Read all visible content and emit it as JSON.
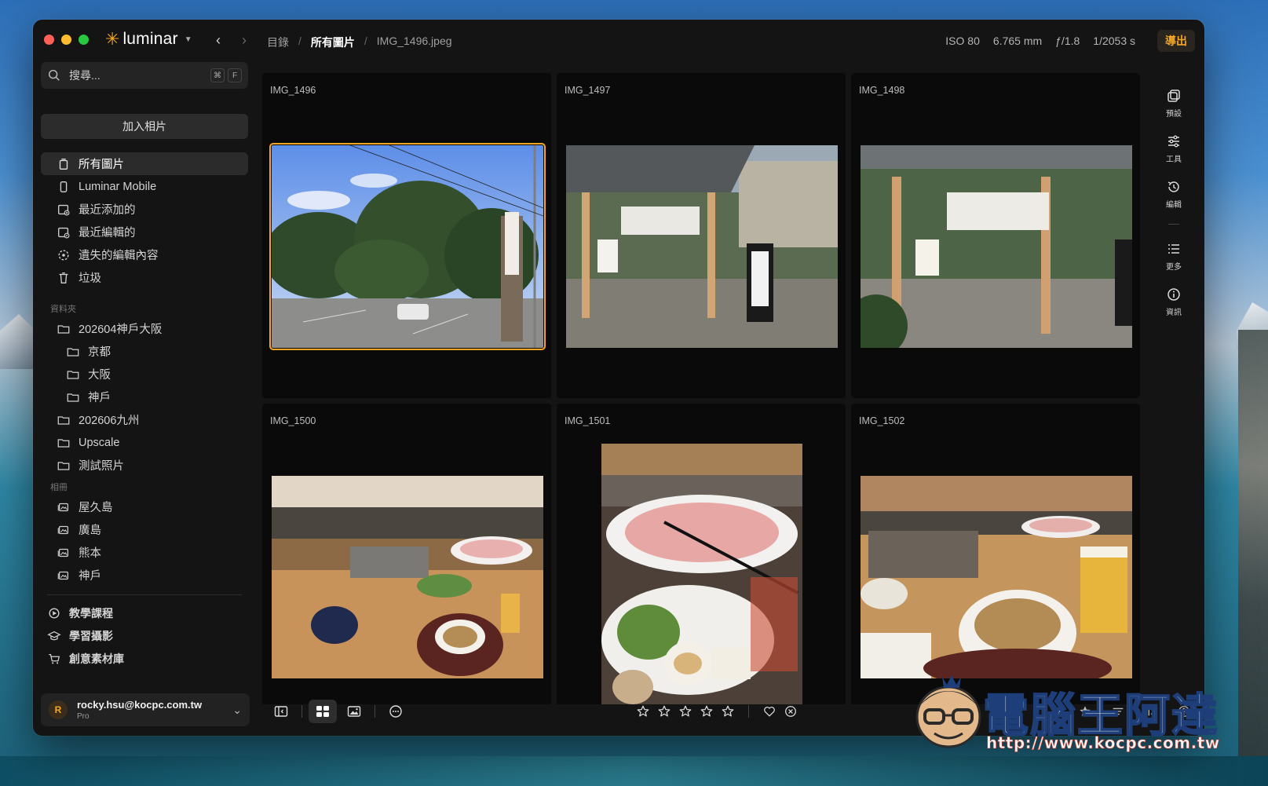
{
  "app": {
    "name": "luminar"
  },
  "breadcrumb": {
    "root": "目錄",
    "folder": "所有圖片",
    "file": "IMG_1496.jpeg"
  },
  "exif": {
    "iso": "ISO 80",
    "focal": "6.765 mm",
    "aperture": "ƒ/1.8",
    "shutter": "1/2053 s"
  },
  "toolbar": {
    "export_label": "導出"
  },
  "search": {
    "placeholder": "搜尋...",
    "key1": "⌘",
    "key2": "F"
  },
  "sidebar": {
    "add_photos": "加入相片",
    "library": [
      {
        "label": "所有圖片",
        "icon": "stack-icon",
        "selected": true
      },
      {
        "label": "Luminar Mobile",
        "icon": "phone-icon"
      },
      {
        "label": "最近添加的",
        "icon": "recently-added-icon"
      },
      {
        "label": "最近編輯的",
        "icon": "recently-edited-icon"
      },
      {
        "label": "遺失的編輯內容",
        "icon": "lost-edits-icon"
      },
      {
        "label": "垃圾",
        "icon": "trash-icon"
      }
    ],
    "folders_label": "資料夾",
    "folders": [
      {
        "label": "202604神戶大阪",
        "sub": false
      },
      {
        "label": "京都",
        "sub": true
      },
      {
        "label": "大阪",
        "sub": true
      },
      {
        "label": "神戶",
        "sub": true
      },
      {
        "label": "202606九州",
        "sub": false
      },
      {
        "label": "Upscale",
        "sub": false
      },
      {
        "label": "測試照片",
        "sub": false
      }
    ],
    "albums_label": "相冊",
    "albums": [
      "屋久島",
      "廣島",
      "熊本",
      "神戶"
    ],
    "extras": [
      {
        "label": "教學課程",
        "icon": "tutorial-icon"
      },
      {
        "label": "學習攝影",
        "icon": "learn-icon"
      },
      {
        "label": "創意素材庫",
        "icon": "cart-icon"
      }
    ]
  },
  "user": {
    "initial": "R",
    "email": "rocky.hsu@kocpc.com.tw",
    "plan": "Pro"
  },
  "photos": [
    "IMG_1496",
    "IMG_1497",
    "IMG_1498",
    "IMG_1500",
    "IMG_1501",
    "IMG_1502"
  ],
  "right_tools": [
    "預設",
    "工具",
    "編輯",
    "更多",
    "資訊"
  ],
  "watermark": {
    "title": "電腦王阿達",
    "url": "http://www.kocpc.com.tw"
  },
  "colors": {
    "accent": "#f5a623",
    "window_bg": "#141414",
    "sidebar_sel": "#2b2b2b"
  }
}
